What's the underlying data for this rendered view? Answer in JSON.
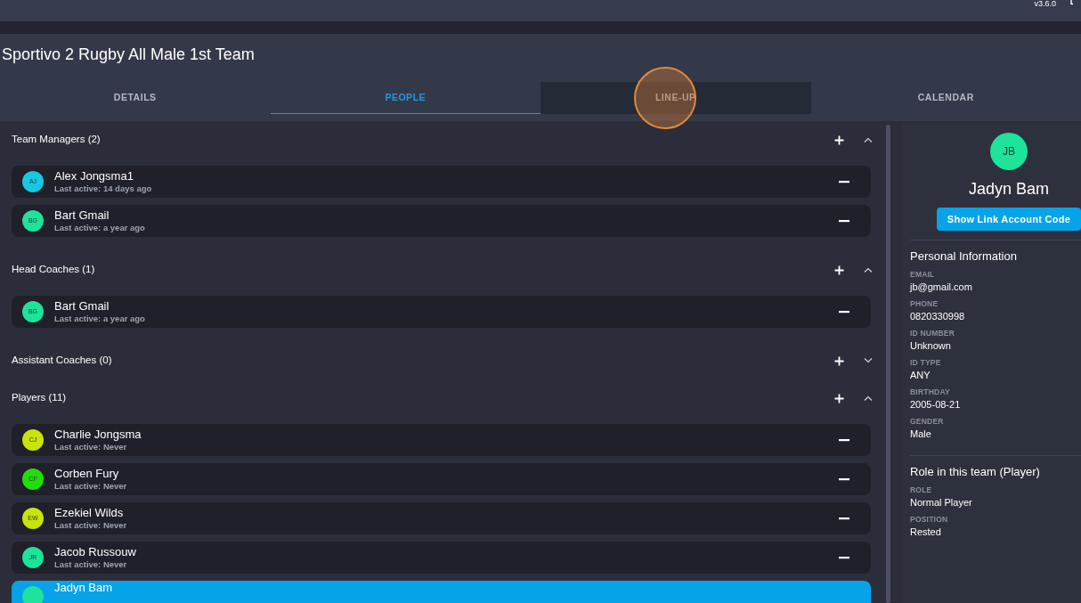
{
  "top_bar": {
    "version": "v3.6.0"
  },
  "team": {
    "title": "Sportivo 2 Rugby All Male 1st Team"
  },
  "tabs": [
    {
      "label": "DETAILS",
      "selected": false,
      "hovered": false
    },
    {
      "label": "PEOPLE",
      "selected": true,
      "hovered": false
    },
    {
      "label": "LINE-UP",
      "selected": false,
      "hovered": true
    },
    {
      "label": "CALENDAR",
      "selected": false,
      "hovered": false
    }
  ],
  "click_marker": {
    "on": true
  },
  "sections": [
    {
      "title": "Team Managers (2)",
      "expanded": true,
      "members": [
        {
          "initials": "AJ",
          "color": "#17c8e3",
          "name": "Alex Jongsma1",
          "last_active": "Last active: 14 days ago",
          "selected": false
        },
        {
          "initials": "BG",
          "color": "#1ee39a",
          "name": "Bart Gmail",
          "last_active": "Last active: a year ago",
          "selected": false
        }
      ]
    },
    {
      "title": "Head Coaches (1)",
      "expanded": true,
      "members": [
        {
          "initials": "BG",
          "color": "#1ee39a",
          "name": "Bart Gmail",
          "last_active": "Last active: a year ago",
          "selected": false
        }
      ]
    },
    {
      "title": "Assistant Coaches (0)",
      "expanded": false
    },
    {
      "title": "Players (11)",
      "expanded": true,
      "members": [
        {
          "initials": "CJ",
          "color": "#c8e40a",
          "name": "Charlie Jongsma",
          "last_active": "Last active: Never",
          "selected": false
        },
        {
          "initials": "CF",
          "color": "#22dd0a",
          "name": "Corben Fury",
          "last_active": "Last active: Never",
          "selected": false
        },
        {
          "initials": "EW",
          "color": "#c8e40a",
          "name": "Ezekiel Wilds",
          "last_active": "Last active: Never",
          "selected": false
        },
        {
          "initials": "JR",
          "color": "#1ee39a",
          "name": "Jacob Russouw",
          "last_active": "Last active: Never",
          "selected": false
        },
        {
          "color": "#1ee39a",
          "name": "Jadyn Bam",
          "selected": true
        }
      ]
    }
  ],
  "profile": {
    "initials": "JB",
    "color": "#1ee39a",
    "name": "Jadyn Bam",
    "link_button": "Show Link Account Code",
    "groups": [
      {
        "title": "Personal Information",
        "fields": [
          {
            "label": "EMAIL",
            "value": "jb@gmail.com"
          },
          {
            "label": "PHONE",
            "value": "0820330998"
          },
          {
            "label": "ID NUMBER",
            "value": "Unknown"
          },
          {
            "label": "ID TYPE",
            "value": "ANY"
          },
          {
            "label": "BIRTHDAY",
            "value": "2005-08-21"
          },
          {
            "label": "GENDER",
            "value": "Male"
          }
        ]
      },
      {
        "title": "Role in this team (Player)",
        "fields": [
          {
            "label": "ROLE",
            "value": "Normal Player"
          },
          {
            "label": "POSITION",
            "value": "Rested"
          }
        ]
      }
    ]
  }
}
